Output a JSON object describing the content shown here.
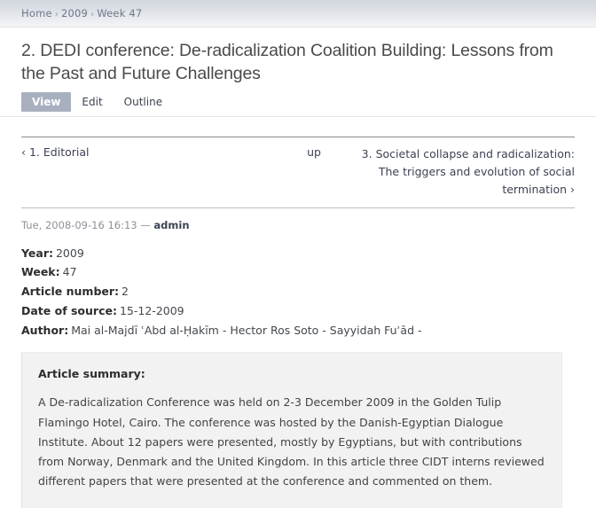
{
  "breadcrumb": {
    "separator": "›",
    "items": [
      {
        "label": "Home"
      },
      {
        "label": "2009"
      },
      {
        "label": "Week 47"
      }
    ]
  },
  "page": {
    "title": "2. DEDI conference: De-radicalization Coalition Building: Lessons from the Past and Future Challenges"
  },
  "tabs": [
    {
      "label": "View",
      "active": true
    },
    {
      "label": "Edit",
      "active": false
    },
    {
      "label": "Outline",
      "active": false
    }
  ],
  "pager": {
    "prev_arrow": "‹",
    "prev_label": "1. Editorial",
    "up_label": "up",
    "next_label": "3. Societal collapse and radicalization: The triggers and evolution of social termination",
    "next_arrow": "›"
  },
  "submitted": {
    "timestamp": "Tue, 2008-09-16 16:13",
    "dash": "—",
    "author": "admin"
  },
  "fields": [
    {
      "label": "Year:",
      "value": "2009"
    },
    {
      "label": "Week:",
      "value": "47"
    },
    {
      "label": "Article number:",
      "value": "2"
    },
    {
      "label": "Date of source:",
      "value": "15-12-2009"
    },
    {
      "label": "Author:",
      "value": "Mai al-Majdī ʿAbd al-Ḥakīm - Hector Ros Soto - Sayyidah Fuʾād -"
    }
  ],
  "summary": {
    "title": "Article summary:",
    "text": "A De-radicalization Conference was held on 2-3 December 2009 in the Golden Tulip Flamingo Hotel, Cairo. The conference was hosted by the Danish-Egyptian Dialogue Institute. About 12 papers were presented, mostly by Egyptians, but with contributions from Norway, Denmark and the United Kingdom. In this article three CIDT interns reviewed different papers that were presented at the conference and commented on them."
  },
  "colors": {
    "active_tab_bg": "#a8b0c0",
    "breadcrumb_text": "#6e7788",
    "summary_bg": "#f2f2f2",
    "text": "#3b3b3b"
  }
}
